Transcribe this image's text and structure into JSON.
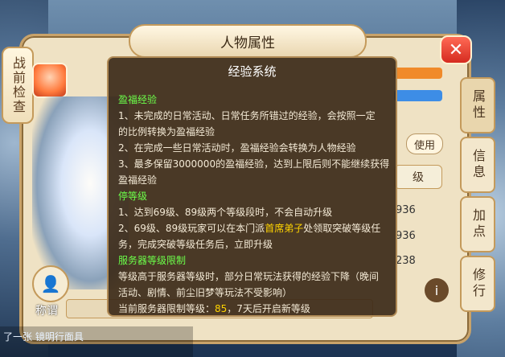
{
  "panel": {
    "title": "人物属性",
    "left_tab": "战前检查",
    "right_tabs": [
      "属性",
      "信息",
      "加点",
      "修行"
    ],
    "title_label": "称谓"
  },
  "behind": {
    "use_button": "使用",
    "level_tab": "级",
    "values": [
      "936",
      "936",
      "238"
    ]
  },
  "popup": {
    "title": "经验系统",
    "sections": {
      "s1_title": "盈福经验",
      "s1_l1": "1、未完成的日常活动、日常任务所错过的经验，会按照一定",
      "s1_l2": "的比例转换为盈福经验",
      "s1_l3": "2、在完成一些日常活动时，盈福经验会转换为人物经验",
      "s1_l4": "3、最多保留3000000的盈福经验，达到上限后则不能继续获得",
      "s1_l5": "盈福经验",
      "s2_title": "停等级",
      "s2_l1": "1、达到69级、89级两个等级段时，不会自动升级",
      "s2_l2a": "2、69级、89级玩家可以在本门派",
      "s2_l2_hl": "首席弟子",
      "s2_l2b": "处领取突破等级任",
      "s2_l3": "务，完成突破等级任务后，立即升级",
      "s3_title": "服务器等级限制",
      "s3_l1": "等级高于服务器等级时，部分日常玩法获得的经验下降（晚间",
      "s3_l2": "活动、剧情、前尘旧梦等玩法不受影响）",
      "s3_l3a": "当前服务器限制等级：",
      "s3_level": "85",
      "s3_l3b": "，7天后开启新等级"
    }
  },
  "colors": {
    "section_title": "#6cff4a",
    "highlight": "#ffd400",
    "popup_bg": "#3c2a18"
  },
  "chat": {
    "text": "了一张 镜明行面具"
  }
}
